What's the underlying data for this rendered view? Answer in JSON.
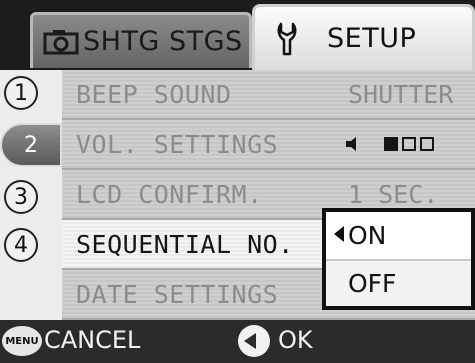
{
  "tabs": [
    {
      "label": "SHTG STGS",
      "icon": "camera-icon",
      "active": false
    },
    {
      "label": "SETUP",
      "icon": "wrench-icon",
      "active": true
    }
  ],
  "pages": [
    "1",
    "2",
    "3",
    "4"
  ],
  "active_page": "2",
  "menu": {
    "items": [
      {
        "label": "BEEP SOUND",
        "value": "SHUTTER"
      },
      {
        "label": "VOL. SETTINGS",
        "value": "",
        "volume_level": 1,
        "volume_max": 3
      },
      {
        "label": "LCD CONFIRM.",
        "value": "1 SEC."
      },
      {
        "label": "SEQUENTIAL NO.",
        "value": ""
      },
      {
        "label": "DATE SETTINGS",
        "value": ""
      }
    ],
    "active_index": 3
  },
  "popup": {
    "options": [
      "ON",
      "OFF"
    ],
    "selected": "ON"
  },
  "footer": {
    "menu_button": "MENU",
    "cancel_label": "CANCEL",
    "ok_label": "OK"
  }
}
